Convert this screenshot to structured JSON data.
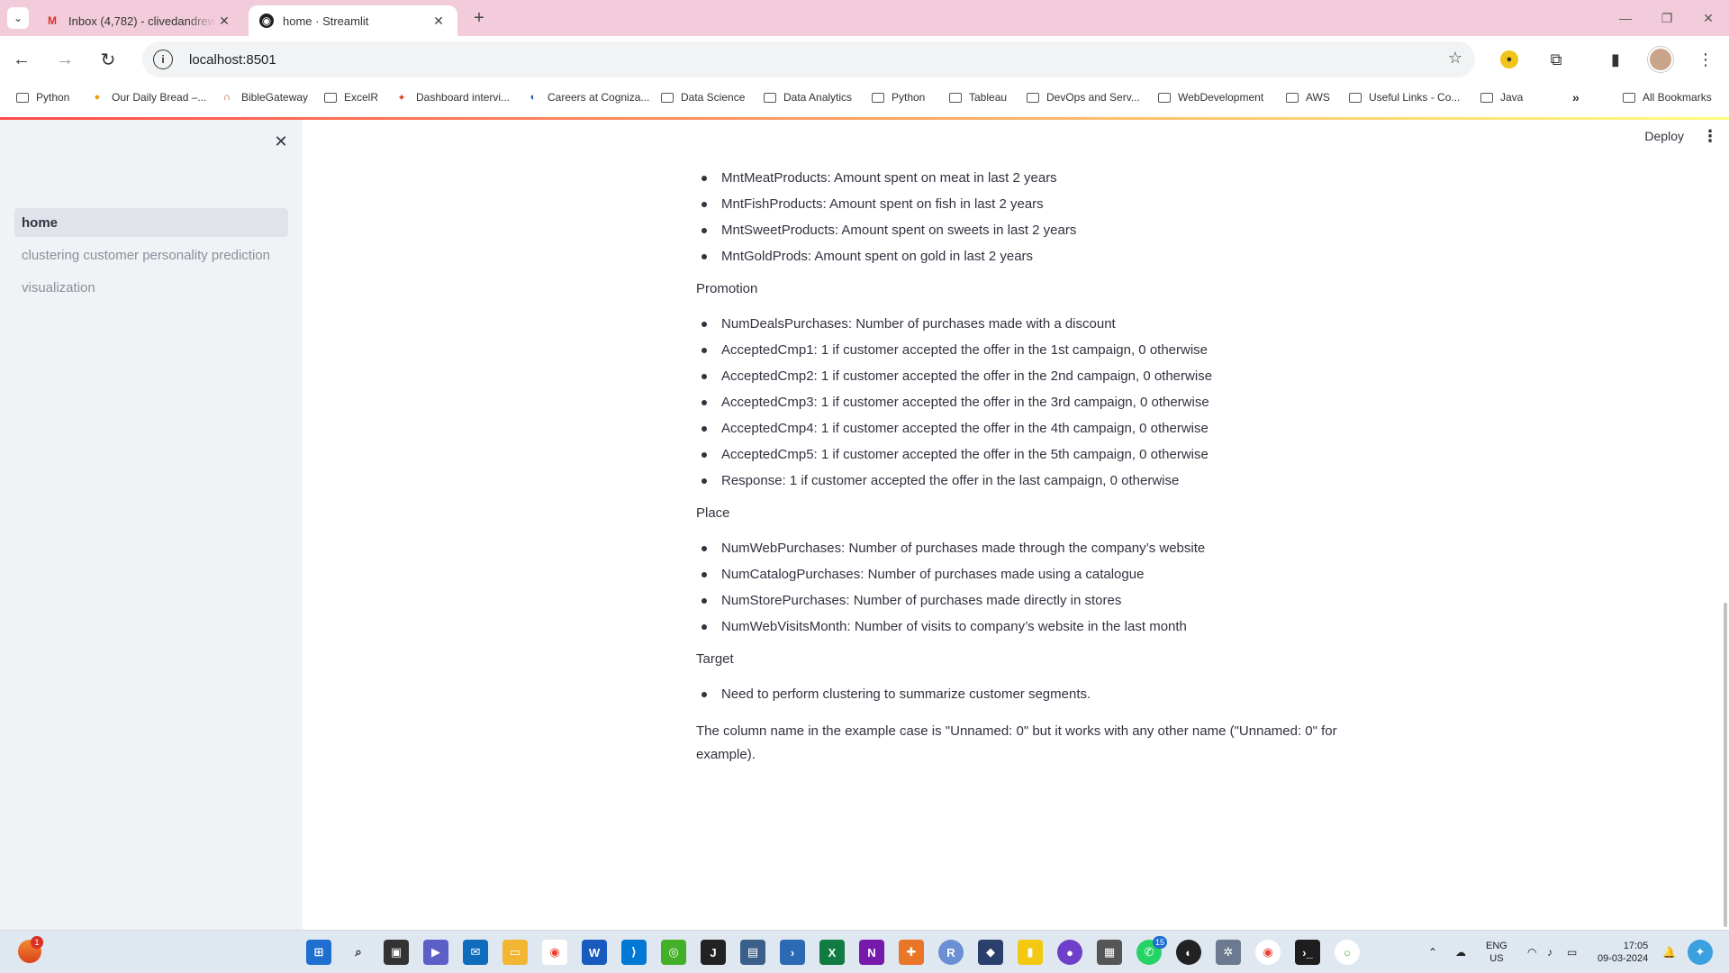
{
  "browser": {
    "tabs": [
      {
        "title": "Inbox (4,782) - clivedandrew",
        "active": false
      },
      {
        "title": "home · Streamlit",
        "active": true
      }
    ],
    "url": "localhost:8501",
    "bookmarks": [
      {
        "label": "Python",
        "icon": "folder-icon"
      },
      {
        "label": "Our Daily Bread –...",
        "icon": "odb-icon"
      },
      {
        "label": "BibleGateway",
        "icon": "biblegateway-icon"
      },
      {
        "label": "ExcelR",
        "icon": "folder-icon"
      },
      {
        "label": "Dashboard intervi...",
        "icon": "dashboard-icon"
      },
      {
        "label": "Careers at Cogniza...",
        "icon": "cognizant-icon"
      },
      {
        "label": "Data Science",
        "icon": "folder-icon"
      },
      {
        "label": "Data Analytics",
        "icon": "folder-icon"
      },
      {
        "label": "Python",
        "icon": "folder-icon"
      },
      {
        "label": "Tableau",
        "icon": "folder-icon"
      },
      {
        "label": "DevOps and Serv...",
        "icon": "folder-icon"
      },
      {
        "label": "WebDevelopment",
        "icon": "folder-icon"
      },
      {
        "label": "AWS",
        "icon": "folder-icon"
      },
      {
        "label": "Useful Links - Co...",
        "icon": "folder-icon"
      },
      {
        "label": "Java",
        "icon": "folder-icon"
      }
    ],
    "more_bookmarks": "»",
    "all_bookmarks": "All Bookmarks"
  },
  "sidebar": {
    "items": [
      {
        "label": "home",
        "active": true
      },
      {
        "label": "clustering customer personality prediction",
        "active": false
      },
      {
        "label": "visualization",
        "active": false
      }
    ]
  },
  "header": {
    "deploy_label": "Deploy"
  },
  "content": {
    "products_list": [
      "MntMeatProducts: Amount spent on meat in last 2 years",
      "MntFishProducts: Amount spent on fish in last 2 years",
      "MntSweetProducts: Amount spent on sweets in last 2 years",
      "MntGoldProds: Amount spent on gold in last 2 years"
    ],
    "promotion_heading": "Promotion",
    "promotion_list": [
      "NumDealsPurchases: Number of purchases made with a discount",
      "AcceptedCmp1: 1 if customer accepted the offer in the 1st campaign, 0 otherwise",
      "AcceptedCmp2: 1 if customer accepted the offer in the 2nd campaign, 0 otherwise",
      "AcceptedCmp3: 1 if customer accepted the offer in the 3rd campaign, 0 otherwise",
      "AcceptedCmp4: 1 if customer accepted the offer in the 4th campaign, 0 otherwise",
      "AcceptedCmp5: 1 if customer accepted the offer in the 5th campaign, 0 otherwise",
      "Response: 1 if customer accepted the offer in the last campaign, 0 otherwise"
    ],
    "place_heading": "Place",
    "place_list": [
      "NumWebPurchases: Number of purchases made through the company’s website",
      "NumCatalogPurchases: Number of purchases made using a catalogue",
      "NumStorePurchases: Number of purchases made directly in stores",
      "NumWebVisitsMonth: Number of visits to company’s website in the last month"
    ],
    "target_heading": "Target",
    "target_list": [
      "Need to perform clustering to summarize customer segments."
    ],
    "footer_paragraph": "The column name in the example case is \"Unnamed: 0\" but it works with any other name (\"Unnamed: 0\" for example)."
  },
  "taskbar": {
    "notification_count": "1",
    "whatsapp_count": "15",
    "lang_line1": "ENG",
    "lang_line2": "US",
    "time": "17:05",
    "date": "09-03-2024"
  },
  "colors": {
    "tabbar_bg": "#f3ccdb",
    "sidebar_bg": "#f0f2f6",
    "text": "#31333f",
    "accent_red": "#ff4b4b"
  }
}
